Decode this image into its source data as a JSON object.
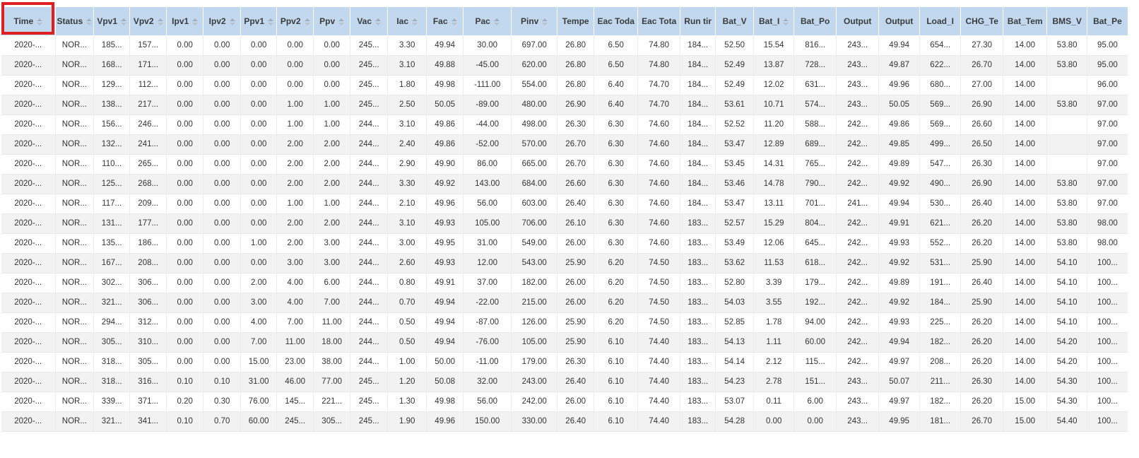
{
  "colors": {
    "header_bg": "#c2d8ef",
    "row_alt": "#f2f2f2",
    "annotation_red": "#e02020"
  },
  "annotation": {
    "type": "highlight-rectangle",
    "target": "Time column header"
  },
  "table": {
    "columns": [
      {
        "key": "time",
        "label": "Time",
        "sortable": true
      },
      {
        "key": "status",
        "label": "Status",
        "sortable": true
      },
      {
        "key": "vpv1",
        "label": "Vpv1",
        "sortable": true
      },
      {
        "key": "vpv2",
        "label": "Vpv2",
        "sortable": true
      },
      {
        "key": "ipv1",
        "label": "Ipv1",
        "sortable": true
      },
      {
        "key": "ipv2",
        "label": "Ipv2",
        "sortable": true
      },
      {
        "key": "ppv1",
        "label": "Ppv1",
        "sortable": true
      },
      {
        "key": "ppv2",
        "label": "Ppv2",
        "sortable": true
      },
      {
        "key": "ppv",
        "label": "Ppv",
        "sortable": true
      },
      {
        "key": "vac",
        "label": "Vac",
        "sortable": true
      },
      {
        "key": "iac",
        "label": "Iac",
        "sortable": true
      },
      {
        "key": "fac",
        "label": "Fac",
        "sortable": true
      },
      {
        "key": "pac",
        "label": "Pac",
        "sortable": true
      },
      {
        "key": "pinv",
        "label": "Pinv",
        "sortable": true
      },
      {
        "key": "temperature",
        "label": "Tempe",
        "sortable": false
      },
      {
        "key": "eac_today",
        "label": "Eac Toda",
        "sortable": false
      },
      {
        "key": "eac_total",
        "label": "Eac Tota",
        "sortable": false
      },
      {
        "key": "run_time",
        "label": "Run tir",
        "sortable": false
      },
      {
        "key": "bat_v",
        "label": "Bat_V",
        "sortable": false
      },
      {
        "key": "bat_i",
        "label": "Bat_I",
        "sortable": true
      },
      {
        "key": "bat_power",
        "label": "Bat_Po",
        "sortable": false
      },
      {
        "key": "output_1",
        "label": "Output",
        "sortable": false
      },
      {
        "key": "output_2",
        "label": "Output",
        "sortable": false
      },
      {
        "key": "load_i",
        "label": "Load_I",
        "sortable": false
      },
      {
        "key": "chg_temp",
        "label": "CHG_Te",
        "sortable": false
      },
      {
        "key": "bat_temp",
        "label": "Bat_Tem",
        "sortable": false
      },
      {
        "key": "bms_v",
        "label": "BMS_V",
        "sortable": false
      },
      {
        "key": "bat_percent",
        "label": "Bat_Pe",
        "sortable": false
      }
    ],
    "rows": [
      [
        "2020-...",
        "NOR...",
        "185...",
        "157...",
        "0.00",
        "0.00",
        "0.00",
        "0.00",
        "0.00",
        "245...",
        "3.30",
        "49.94",
        "30.00",
        "697.00",
        "26.80",
        "6.50",
        "74.80",
        "184...",
        "52.50",
        "15.54",
        "816...",
        "243...",
        "49.94",
        "654...",
        "27.30",
        "14.00",
        "53.80",
        "95.00"
      ],
      [
        "2020-...",
        "NOR...",
        "168...",
        "171...",
        "0.00",
        "0.00",
        "0.00",
        "0.00",
        "0.00",
        "245...",
        "3.10",
        "49.88",
        "-45.00",
        "620.00",
        "26.80",
        "6.50",
        "74.80",
        "184...",
        "52.49",
        "13.87",
        "728...",
        "243...",
        "49.87",
        "622...",
        "26.70",
        "14.00",
        "53.80",
        "95.00"
      ],
      [
        "2020-...",
        "NOR...",
        "129...",
        "112...",
        "0.00",
        "0.00",
        "0.00",
        "0.00",
        "0.00",
        "245...",
        "1.80",
        "49.98",
        "-111.00",
        "554.00",
        "26.80",
        "6.40",
        "74.70",
        "184...",
        "52.49",
        "12.02",
        "631...",
        "243...",
        "49.96",
        "680...",
        "27.00",
        "14.00",
        "",
        "96.00"
      ],
      [
        "2020-...",
        "NOR...",
        "138...",
        "217...",
        "0.00",
        "0.00",
        "0.00",
        "1.00",
        "1.00",
        "245...",
        "2.50",
        "50.05",
        "-89.00",
        "480.00",
        "26.90",
        "6.40",
        "74.70",
        "184...",
        "53.61",
        "10.71",
        "574...",
        "243...",
        "50.05",
        "569...",
        "26.90",
        "14.00",
        "53.80",
        "97.00"
      ],
      [
        "2020-...",
        "NOR...",
        "156...",
        "246...",
        "0.00",
        "0.00",
        "0.00",
        "1.00",
        "1.00",
        "244...",
        "3.10",
        "49.86",
        "-44.00",
        "498.00",
        "26.30",
        "6.30",
        "74.60",
        "184...",
        "52.52",
        "11.20",
        "588...",
        "242...",
        "49.86",
        "569...",
        "26.60",
        "14.00",
        "",
        "97.00"
      ],
      [
        "2020-...",
        "NOR...",
        "132...",
        "241...",
        "0.00",
        "0.00",
        "0.00",
        "2.00",
        "2.00",
        "244...",
        "2.40",
        "49.86",
        "-52.00",
        "570.00",
        "26.70",
        "6.30",
        "74.60",
        "184...",
        "53.47",
        "12.89",
        "689...",
        "242...",
        "49.85",
        "499...",
        "26.50",
        "14.00",
        "",
        "97.00"
      ],
      [
        "2020-...",
        "NOR...",
        "110...",
        "265...",
        "0.00",
        "0.00",
        "0.00",
        "2.00",
        "2.00",
        "244...",
        "2.90",
        "49.90",
        "86.00",
        "665.00",
        "26.70",
        "6.30",
        "74.60",
        "184...",
        "53.45",
        "14.31",
        "765...",
        "242...",
        "49.89",
        "547...",
        "26.30",
        "14.00",
        "",
        "97.00"
      ],
      [
        "2020-...",
        "NOR...",
        "125...",
        "268...",
        "0.00",
        "0.00",
        "0.00",
        "2.00",
        "2.00",
        "244...",
        "3.30",
        "49.92",
        "143.00",
        "684.00",
        "26.60",
        "6.30",
        "74.60",
        "184...",
        "53.46",
        "14.78",
        "790...",
        "242...",
        "49.92",
        "490...",
        "26.90",
        "14.00",
        "53.80",
        "97.00"
      ],
      [
        "2020-...",
        "NOR...",
        "117...",
        "209...",
        "0.00",
        "0.00",
        "0.00",
        "1.00",
        "1.00",
        "244...",
        "2.10",
        "49.96",
        "56.00",
        "603.00",
        "26.40",
        "6.30",
        "74.60",
        "184...",
        "53.47",
        "13.11",
        "701...",
        "241...",
        "49.94",
        "530...",
        "26.40",
        "14.00",
        "53.80",
        "97.00"
      ],
      [
        "2020-...",
        "NOR...",
        "131...",
        "177...",
        "0.00",
        "0.00",
        "0.00",
        "2.00",
        "2.00",
        "244...",
        "3.10",
        "49.93",
        "105.00",
        "706.00",
        "26.10",
        "6.30",
        "74.60",
        "183...",
        "52.57",
        "15.29",
        "804...",
        "242...",
        "49.91",
        "621...",
        "26.20",
        "14.00",
        "53.80",
        "98.00"
      ],
      [
        "2020-...",
        "NOR...",
        "135...",
        "186...",
        "0.00",
        "0.00",
        "1.00",
        "2.00",
        "3.00",
        "244...",
        "3.00",
        "49.95",
        "31.00",
        "549.00",
        "26.00",
        "6.30",
        "74.60",
        "183...",
        "53.49",
        "12.06",
        "645...",
        "242...",
        "49.93",
        "552...",
        "26.20",
        "14.00",
        "53.80",
        "98.00"
      ],
      [
        "2020-...",
        "NOR...",
        "167...",
        "208...",
        "0.00",
        "0.00",
        "0.00",
        "3.00",
        "3.00",
        "244...",
        "2.60",
        "49.93",
        "12.00",
        "543.00",
        "25.90",
        "6.20",
        "74.50",
        "183...",
        "53.62",
        "11.53",
        "618...",
        "242...",
        "49.92",
        "531...",
        "25.90",
        "14.00",
        "54.10",
        "100..."
      ],
      [
        "2020-...",
        "NOR...",
        "302...",
        "306...",
        "0.00",
        "0.00",
        "2.00",
        "4.00",
        "6.00",
        "244...",
        "0.80",
        "49.91",
        "37.00",
        "182.00",
        "26.00",
        "6.20",
        "74.50",
        "183...",
        "52.80",
        "3.39",
        "179...",
        "242...",
        "49.89",
        "191...",
        "26.40",
        "14.00",
        "54.10",
        "100..."
      ],
      [
        "2020-...",
        "NOR...",
        "321...",
        "306...",
        "0.00",
        "0.00",
        "3.00",
        "4.00",
        "7.00",
        "244...",
        "0.70",
        "49.94",
        "-22.00",
        "215.00",
        "26.00",
        "6.20",
        "74.50",
        "183...",
        "54.03",
        "3.55",
        "192...",
        "242...",
        "49.92",
        "184...",
        "25.90",
        "14.00",
        "54.10",
        "100..."
      ],
      [
        "2020-...",
        "NOR...",
        "294...",
        "312...",
        "0.00",
        "0.00",
        "4.00",
        "7.00",
        "11.00",
        "244...",
        "0.50",
        "49.94",
        "-87.00",
        "126.00",
        "25.90",
        "6.20",
        "74.50",
        "183...",
        "52.85",
        "1.78",
        "94.00",
        "242...",
        "49.93",
        "225...",
        "26.20",
        "14.00",
        "54.10",
        "100..."
      ],
      [
        "2020-...",
        "NOR...",
        "305...",
        "310...",
        "0.00",
        "0.00",
        "7.00",
        "11.00",
        "18.00",
        "244...",
        "0.50",
        "49.94",
        "-76.00",
        "105.00",
        "25.90",
        "6.10",
        "74.40",
        "183...",
        "54.13",
        "1.11",
        "60.00",
        "242...",
        "49.94",
        "182...",
        "26.20",
        "14.00",
        "54.20",
        "100..."
      ],
      [
        "2020-...",
        "NOR...",
        "318...",
        "305...",
        "0.00",
        "0.00",
        "15.00",
        "23.00",
        "38.00",
        "244...",
        "1.00",
        "50.00",
        "-11.00",
        "179.00",
        "26.30",
        "6.10",
        "74.40",
        "183...",
        "54.14",
        "2.12",
        "115...",
        "242...",
        "49.97",
        "208...",
        "26.20",
        "14.00",
        "54.20",
        "100..."
      ],
      [
        "2020-...",
        "NOR...",
        "318...",
        "316...",
        "0.10",
        "0.10",
        "31.00",
        "46.00",
        "77.00",
        "245...",
        "1.20",
        "50.08",
        "32.00",
        "243.00",
        "26.40",
        "6.10",
        "74.40",
        "183...",
        "54.23",
        "2.78",
        "151...",
        "243...",
        "50.07",
        "211...",
        "26.30",
        "14.00",
        "54.30",
        "100..."
      ],
      [
        "2020-...",
        "NOR...",
        "339...",
        "371...",
        "0.20",
        "0.30",
        "76.00",
        "145...",
        "221...",
        "245...",
        "1.30",
        "49.98",
        "56.00",
        "242.00",
        "26.00",
        "6.10",
        "74.40",
        "183...",
        "53.07",
        "0.11",
        "6.00",
        "243...",
        "49.97",
        "182...",
        "26.20",
        "15.00",
        "54.30",
        "100..."
      ],
      [
        "2020-...",
        "NOR...",
        "321...",
        "341...",
        "0.10",
        "0.70",
        "60.00",
        "245...",
        "305...",
        "245...",
        "1.90",
        "49.96",
        "150.00",
        "330.00",
        "26.40",
        "6.10",
        "74.40",
        "183...",
        "54.28",
        "0.00",
        "0.00",
        "243...",
        "49.95",
        "181...",
        "26.70",
        "15.00",
        "54.40",
        "100..."
      ]
    ]
  }
}
